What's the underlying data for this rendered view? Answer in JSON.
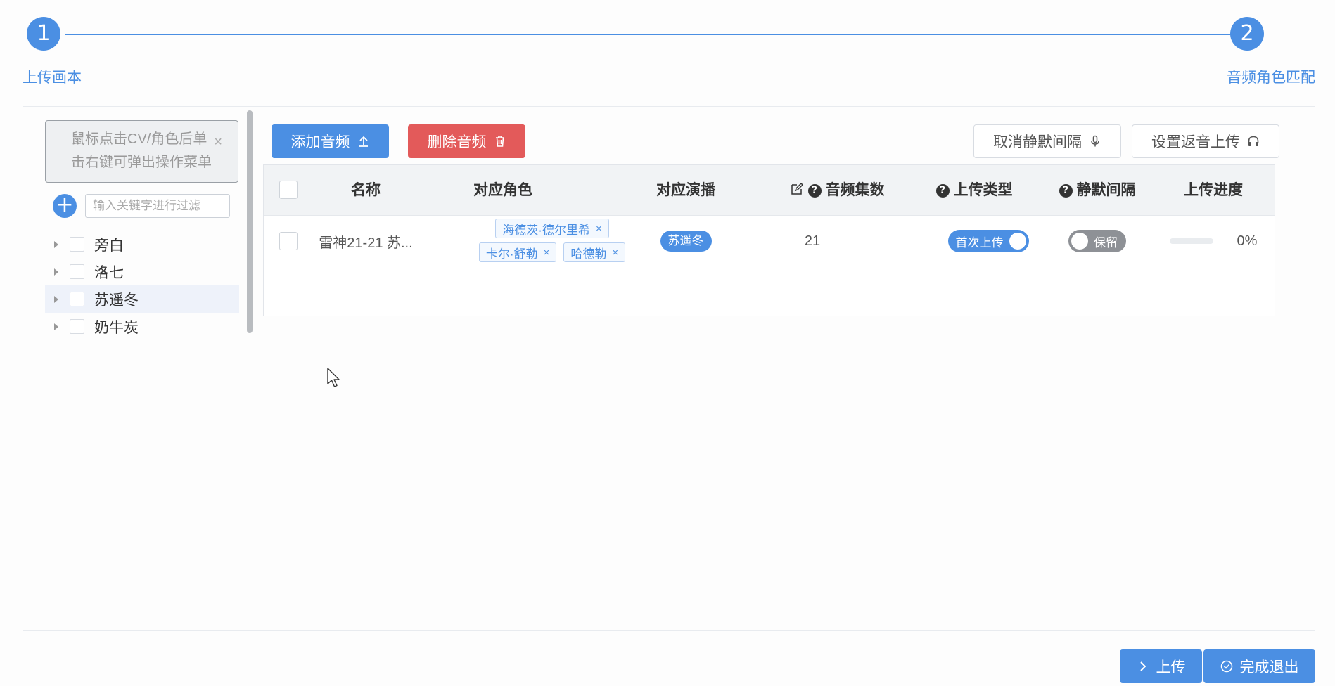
{
  "steps": [
    {
      "number": "1",
      "label": "上传画本"
    },
    {
      "number": "2",
      "label": "音频角色匹配"
    }
  ],
  "sidebar": {
    "hint_line1": "鼠标点击CV/角色后单",
    "hint_line2": "击右键可弹出操作菜单",
    "hint_close": "×",
    "add_symbol": "+",
    "filter_placeholder": "输入关键字进行过滤",
    "tree_items": [
      {
        "label": "旁白",
        "selected": false
      },
      {
        "label": "洛七",
        "selected": false
      },
      {
        "label": "苏遥冬",
        "selected": true
      },
      {
        "label": "奶牛炭",
        "selected": false
      }
    ]
  },
  "toolbar": {
    "add_audio": "添加音频",
    "delete_audio": "删除音频",
    "cancel_silence": "取消静默间隔",
    "set_return_upload": "设置返音上传"
  },
  "table": {
    "headers": {
      "name": "名称",
      "roles": "对应角色",
      "cv": "对应演播",
      "episodes": "音频集数",
      "upload_type": "上传类型",
      "silence": "静默间隔",
      "progress": "上传进度"
    },
    "help_symbol": "?",
    "rows": [
      {
        "name": "雷神21-21 苏...",
        "roles": [
          "海德茨·德尔里希",
          "卡尔·舒勒",
          "哈德勒"
        ],
        "tag_close": "×",
        "cv": "苏遥冬",
        "episodes": "21",
        "upload_type": "首次上传",
        "upload_type_on": true,
        "silence": "保留",
        "silence_on": false,
        "progress": 0,
        "progress_text": "0%"
      }
    ]
  },
  "footer": {
    "upload": "上传",
    "finish_exit": "完成退出"
  },
  "colors": {
    "primary": "#4b8fe3",
    "danger": "#e35a5a",
    "switch_off": "#8e9196"
  }
}
